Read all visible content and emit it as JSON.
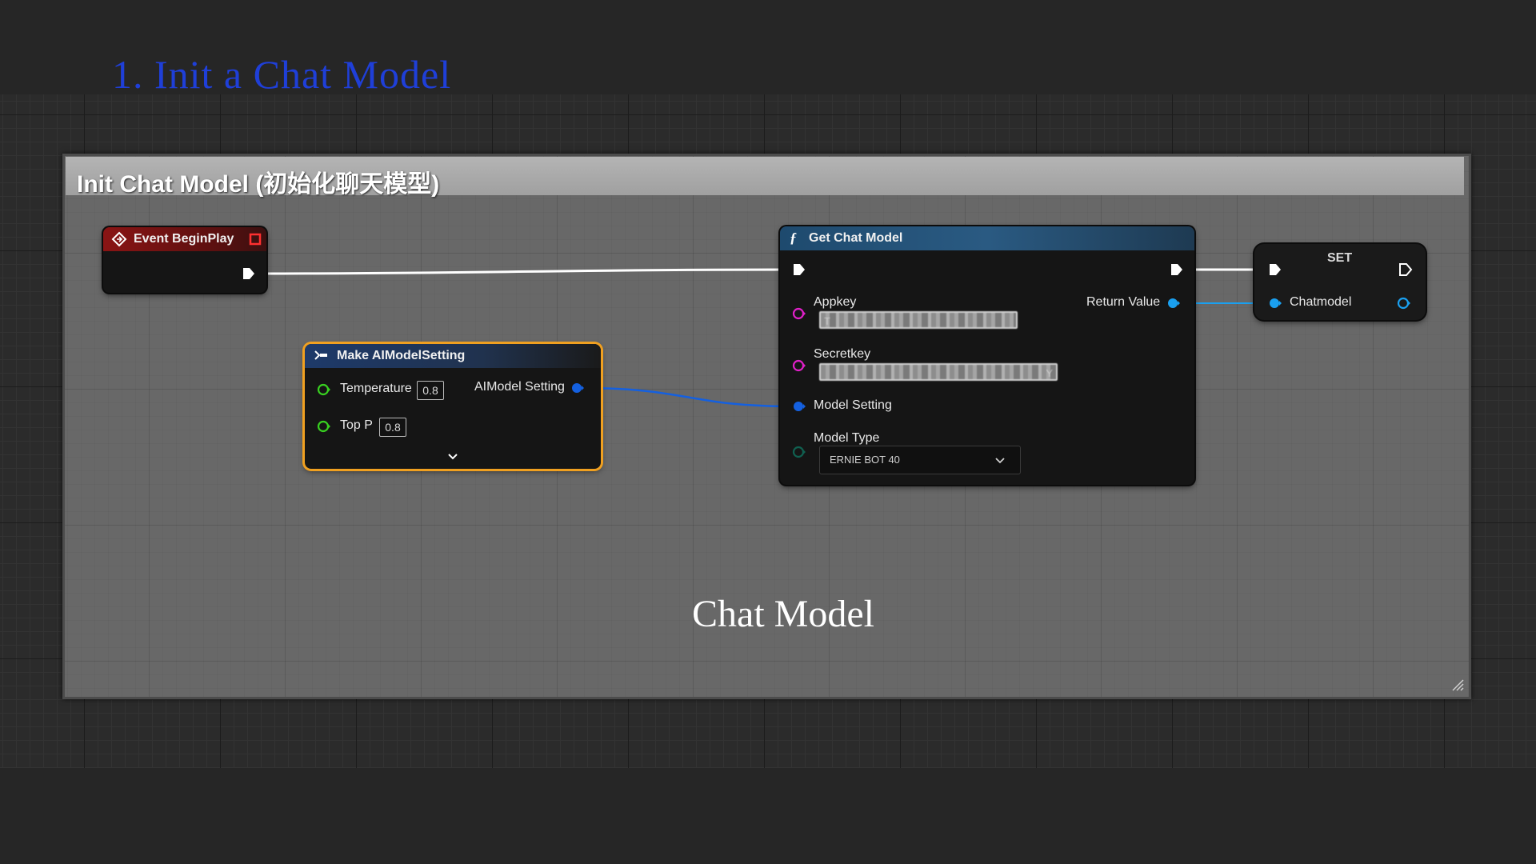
{
  "slide": {
    "title": "1. Init a Chat Model"
  },
  "comment": {
    "title": "Init Chat Model (初始化聊天模型)"
  },
  "caption": "Chat Model",
  "nodes": {
    "event_begin_play": {
      "title": "Event BeginPlay",
      "header_color": "#8a1414"
    },
    "make_ai_model_setting": {
      "title": "Make AIModelSetting",
      "temperature_label": "Temperature",
      "temperature_value": "0.8",
      "top_p_label": "Top P",
      "top_p_value": "0.8",
      "output_label": "AIModel Setting",
      "border_color": "#f0a020"
    },
    "get_chat_model": {
      "title": "Get Chat Model",
      "appkey_label": "Appkey",
      "appkey_value": "T",
      "secretkey_label": "Secretkey",
      "secretkey_value": "Y",
      "model_setting_label": "Model Setting",
      "model_type_label": "Model Type",
      "model_type_value": "ERNIE BOT 40",
      "return_label": "Return Value",
      "header_color": "#1e4a6e"
    },
    "set_node": {
      "title": "SET",
      "variable_label": "Chatmodel"
    }
  },
  "colors": {
    "exec_pin": "#ffffff",
    "string_pin": "#e020c8",
    "struct_pin": "#1460e0",
    "float_pin": "#38d020",
    "object_pin": "#1aa0f0",
    "enum_pin": "#106050"
  }
}
